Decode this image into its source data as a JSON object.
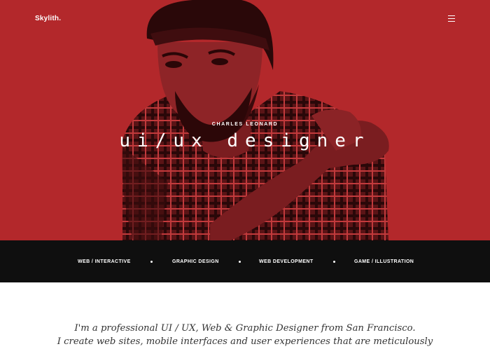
{
  "header": {
    "logo": "Skylith.",
    "menu_icon": "hamburger-menu-icon"
  },
  "hero": {
    "subtitle": "CHARLES LEONARD",
    "title": "ui/ux designer",
    "background_color": "#b3282b",
    "image": "red-toned-portrait-of-bearded-man-in-beanie-and-plaid-shirt"
  },
  "services": [
    {
      "label": "WEB / INTERACTIVE"
    },
    {
      "label": "GRAPHIC DESIGN"
    },
    {
      "label": "WEB DEVELOPMENT"
    },
    {
      "label": "GAME / ILLUSTRATION"
    }
  ],
  "intro": {
    "line1": "I'm a professional UI / UX, Web & Graphic Designer from San Francisco.",
    "line2": "I create web sites, mobile interfaces and user experiences that are meticulously"
  },
  "colors": {
    "hero_red": "#b3282b",
    "band_black": "#0f0f0f",
    "text": "#333333"
  }
}
